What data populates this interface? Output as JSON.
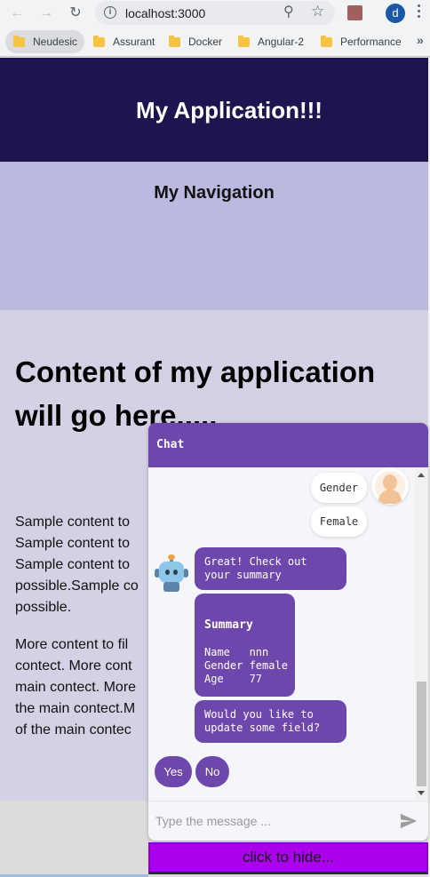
{
  "browser": {
    "url": "localhost:3000",
    "avatar_letter": "d",
    "bookmarks": [
      "Neudesic",
      "Assurant",
      "Docker",
      "Angular-2",
      "Performance"
    ],
    "more_bookmarks": "»"
  },
  "page": {
    "header_title": "My Application!!!",
    "nav_title": "My Navigation",
    "content_heading": "Content of my application will go here.....",
    "para1_lines": [
      "Sample content to",
      "Sample content to",
      "Sample content to",
      "possible.Sample co",
      "possible."
    ],
    "para2_lines": [
      "More content to fil",
      "contect. More cont",
      "main contect. More",
      "the main contect.M",
      "of the main contec"
    ]
  },
  "chat": {
    "title": "Chat",
    "messages": {
      "user_gender": "Gender",
      "user_female": "Female",
      "bot_great": "Great! Check out your summary",
      "summary_title": "Summary",
      "summary_rows": [
        "Name   nnn",
        "Gender female",
        "Age    77"
      ],
      "bot_update": "Would you like to update some field?"
    },
    "choices": [
      "Yes",
      "No"
    ],
    "input_placeholder": "Type the message ...",
    "hide_button": "click to hide..."
  },
  "colors": {
    "header_bg": "#1e1450",
    "nav_bg": "#bbb9e0",
    "content_bg": "#d3d1e3",
    "chat_accent": "#6e47ac",
    "hide_button_bg": "#aa00ee"
  }
}
